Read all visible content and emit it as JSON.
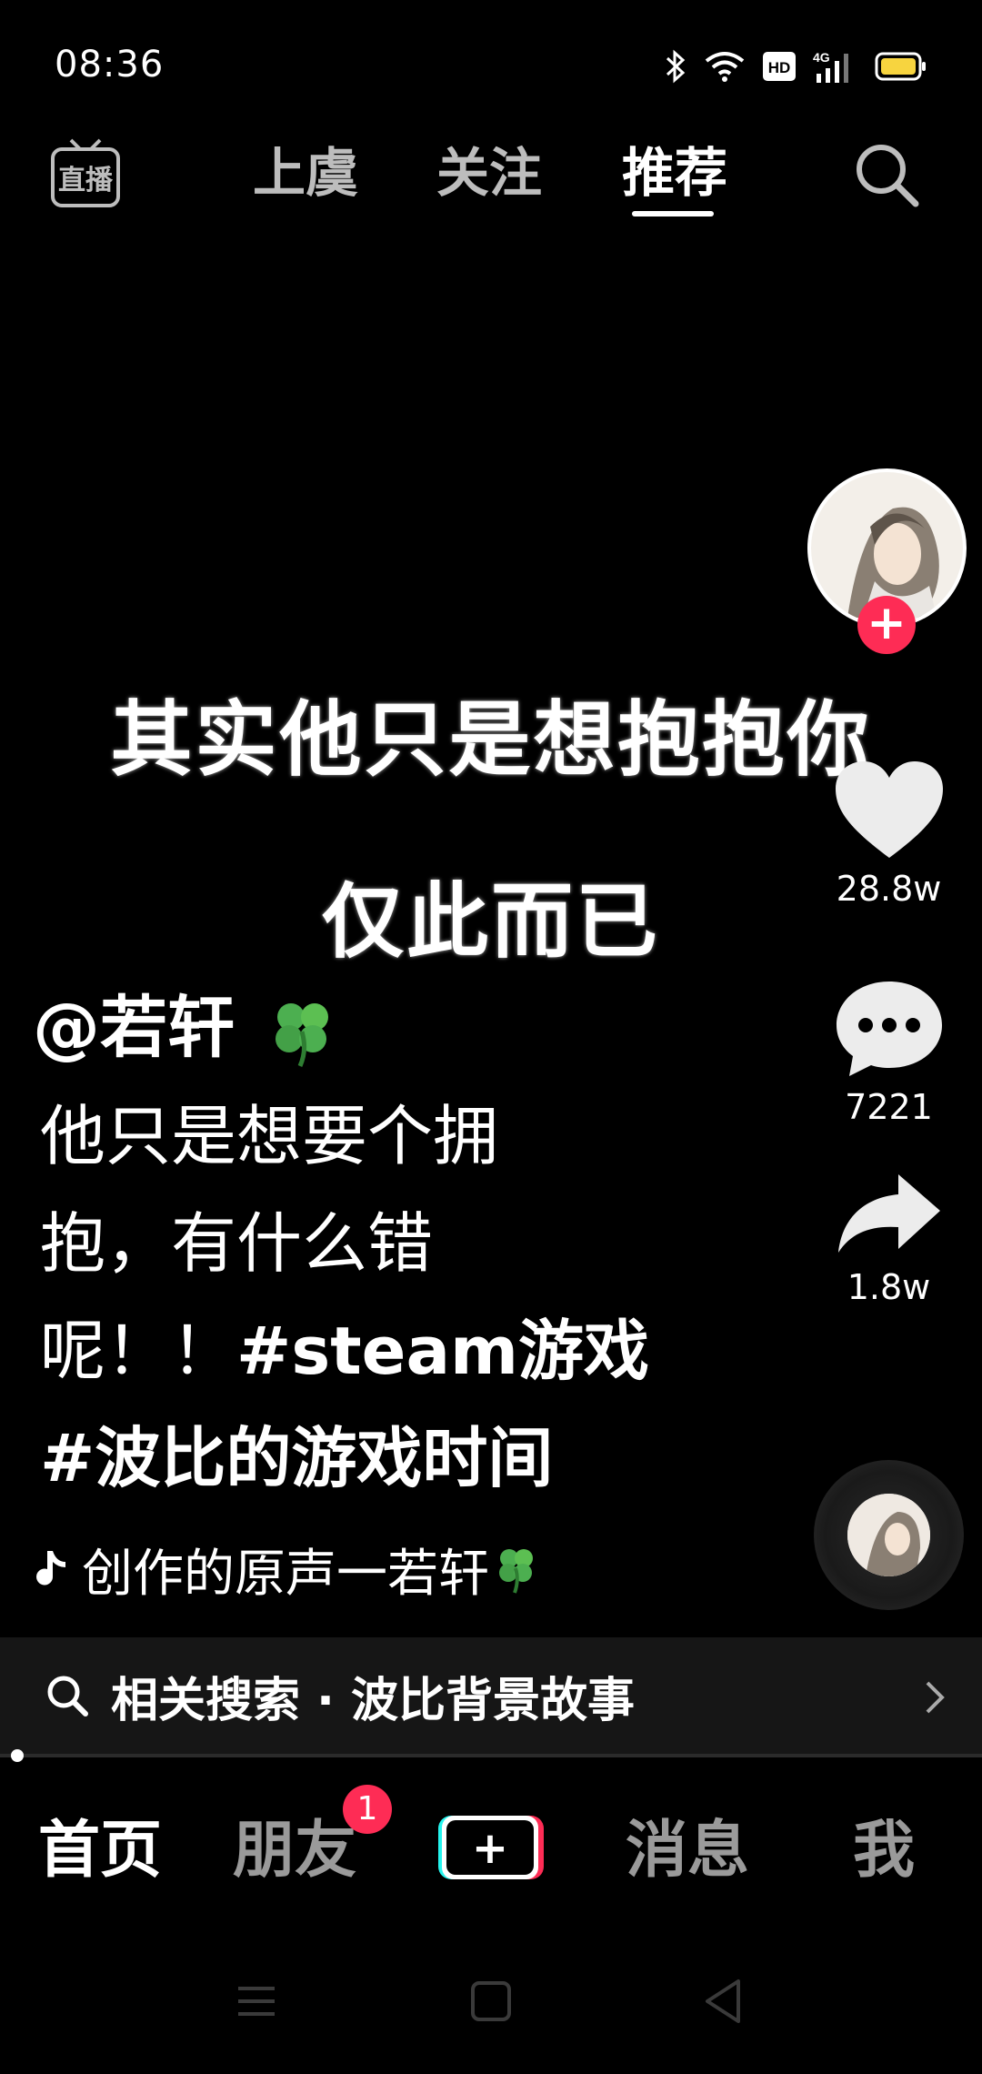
{
  "status_bar": {
    "time": "08:36",
    "icons": [
      "bluetooth-icon",
      "wifi-icon",
      "hd-icon",
      "4g-signal-icon",
      "battery-icon"
    ],
    "hd_label": "HD",
    "network_label": "4G"
  },
  "top_nav": {
    "live_label": "直播",
    "tabs": [
      {
        "label": "上虞"
      },
      {
        "label": "关注"
      },
      {
        "label": "推荐"
      }
    ],
    "active_tab": "推荐"
  },
  "video": {
    "caption_line1": "其实他只是想抱抱你",
    "caption_line2": "仅此而已"
  },
  "actions": {
    "likes": "28.8w",
    "comments": "7221",
    "shares": "1.8w",
    "follow_symbol": "+"
  },
  "post": {
    "author": "@若轩",
    "description_lines": [
      "他只是想要个拥",
      "抱，有什么错",
      "呢！！",
      "#波比的游戏时间"
    ],
    "hashtag_inline": "#steam游戏",
    "music": "创作的原声一若轩"
  },
  "related_search": {
    "text": "相关搜索 · 波比背景故事"
  },
  "bottom_nav": {
    "items": [
      {
        "label": "首页"
      },
      {
        "label": "朋友"
      },
      {
        "label": "消息"
      },
      {
        "label": "我"
      }
    ],
    "friends_badge": "1",
    "create_symbol": "+"
  },
  "colors": {
    "accent": "#fe2c55",
    "background": "#000000",
    "inactive_text": "#9a9a9a",
    "battery": "#f7d43f"
  }
}
